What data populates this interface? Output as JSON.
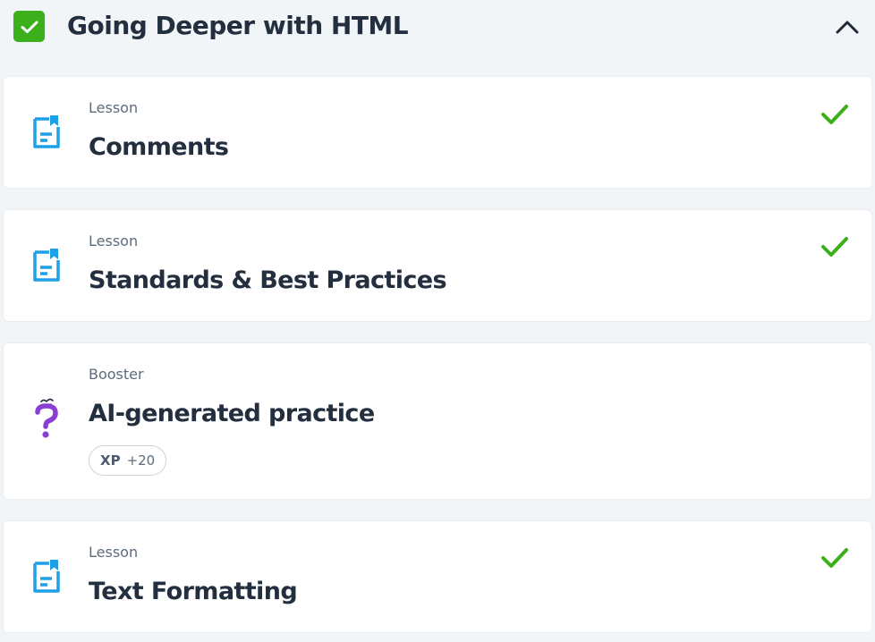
{
  "section": {
    "title": "Going Deeper with HTML",
    "completed": true,
    "check_icon": "checkbox-checked-icon",
    "collapse_icon": "chevron-up-icon",
    "accent_color": "#3cb01a"
  },
  "items": [
    {
      "type": "Lesson",
      "title": "Comments",
      "icon": "lesson-document-icon",
      "completed": true
    },
    {
      "type": "Lesson",
      "title": "Standards & Best Practices",
      "icon": "lesson-document-icon",
      "completed": true
    },
    {
      "type": "Booster",
      "title": "AI-generated practice",
      "icon": "question-mark-character-icon",
      "completed": false,
      "xp": {
        "label": "XP",
        "value": "+20"
      }
    },
    {
      "type": "Lesson",
      "title": "Text Formatting",
      "icon": "lesson-document-icon",
      "completed": true
    }
  ],
  "colors": {
    "page_bg": "#f2f5f8",
    "card_bg": "#ffffff",
    "lesson_icon": "#1ea0e8",
    "booster_icon": "#8a3fd3",
    "done_check": "#3cb01a",
    "title_text": "#232f3e",
    "subtle_text": "#5c6b7d"
  }
}
